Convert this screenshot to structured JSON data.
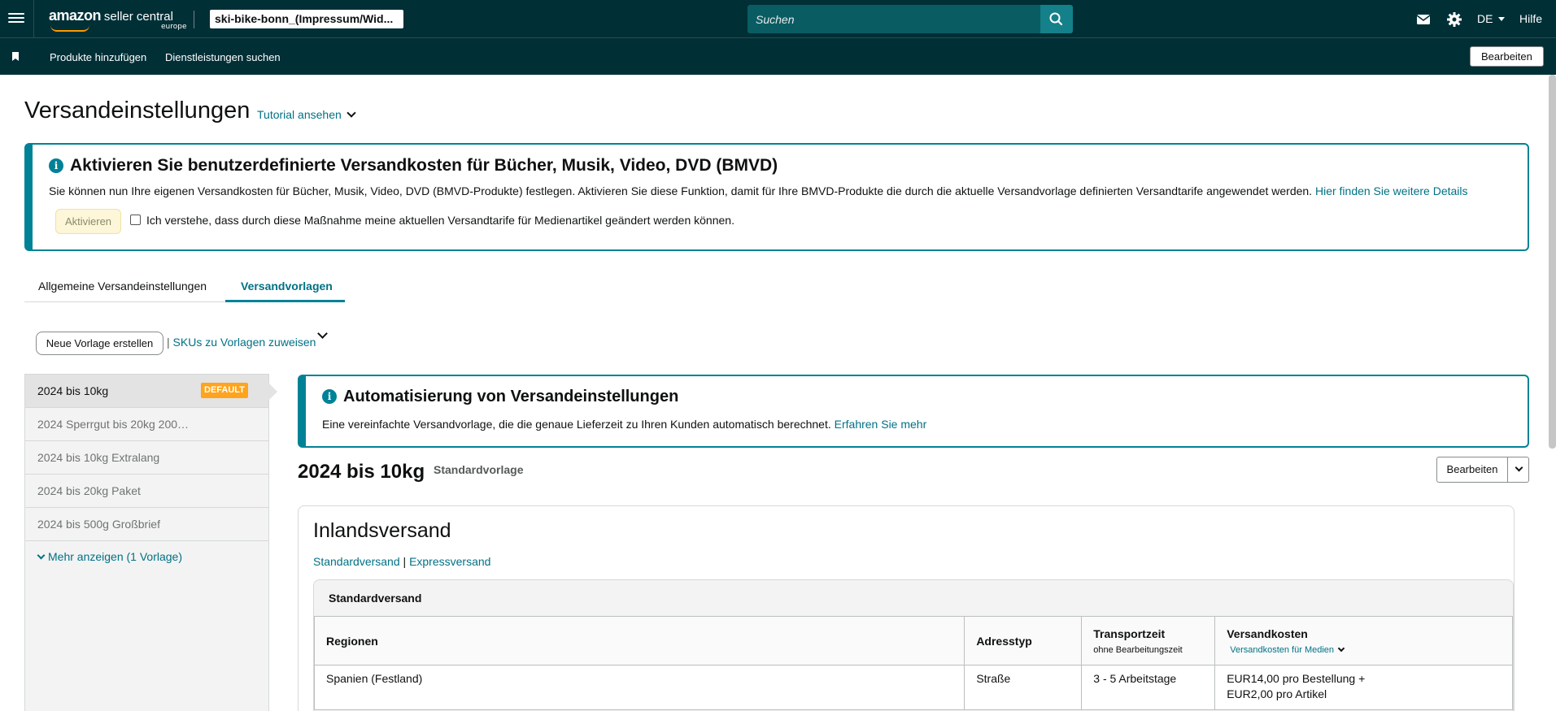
{
  "header": {
    "logo_main": "amazon",
    "logo_rest": "seller central",
    "logo_sub": "europe",
    "account": "ski-bike-bonn_(Impressum/Wid...",
    "search_placeholder": "Suchen",
    "language": "DE",
    "help": "Hilfe",
    "icons": [
      "menu-icon",
      "mail-icon",
      "gear-icon",
      "search-icon",
      "bookmark-icon"
    ]
  },
  "subnav": {
    "items": [
      "Produkte hinzufügen",
      "Dienstleistungen suchen"
    ],
    "edit": "Bearbeiten"
  },
  "page": {
    "title": "Versandeinstellungen",
    "tutorial": "Tutorial ansehen"
  },
  "bmvd_alert": {
    "title": "Aktivieren Sie benutzerdefinierte Versandkosten für Bücher, Musik, Video, DVD (BMVD)",
    "text": "Sie können nun Ihre eigenen Versandkosten für Bücher, Musik, Video, DVD (BMVD-Produkte) festlegen. Aktivieren Sie diese Funktion, damit für Ihre BMVD-Produkte die durch die aktuelle Versandvorlage definierten Versandtarife angewendet werden.",
    "link": "Hier finden Sie weitere Details",
    "button": "Aktivieren",
    "checkbox_label": "Ich verstehe, dass durch diese Maßnahme meine aktuellen Versandtarife für Medienartikel geändert werden können.",
    "checked": false
  },
  "tabs": [
    {
      "label": "Allgemeine Versandeinstellungen",
      "active": false
    },
    {
      "label": "Versandvorlagen",
      "active": true
    }
  ],
  "actions": {
    "new_template": "Neue Vorlage erstellen",
    "pipe": "|",
    "assign": "SKUs zu Vorlagen zuweisen"
  },
  "templates": {
    "items": [
      {
        "label": "2024 bis 10kg",
        "active": true,
        "badge": "DEFAULT"
      },
      {
        "label": "2024 Sperrgut bis 20kg 200…",
        "active": false
      },
      {
        "label": "2024 bis 10kg Extralang",
        "active": false
      },
      {
        "label": "2024 bis 20kg Paket",
        "active": false
      },
      {
        "label": "2024 bis 500g Großbrief",
        "active": false
      }
    ],
    "more": "Mehr anzeigen (1 Vorlage)"
  },
  "auto_alert": {
    "title": "Automatisierung von Versandeinstellungen",
    "text": "Eine vereinfachte Versandvorlage, die die genaue Lieferzeit zu Ihren Kunden automatisch berechnet.",
    "link": "Erfahren Sie mehr"
  },
  "template_detail": {
    "title": "2024 bis 10kg",
    "type": "Standardvorlage",
    "edit": "Bearbeiten",
    "section_title": "Inlandsversand",
    "link_standard": "Standardversand",
    "pipe": "|",
    "link_express": "Expressversand",
    "table_title": "Standardversand",
    "columns": {
      "regions": "Regionen",
      "address_type": "Adresstyp",
      "transit": "Transportzeit",
      "transit_sub": "ohne Bearbeitungszeit",
      "cost": "Versandkosten",
      "cost_link": "Versandkosten für Medien"
    },
    "rows": [
      {
        "region": "Spanien (Festland)",
        "address": "Straße",
        "transit": "3 - 5 Arbeitstage",
        "cost_line1": "EUR14,00 pro Bestellung +",
        "cost_line2": "EUR2,00 pro Artikel"
      }
    ]
  },
  "colors": {
    "nav_bg": "#002f36",
    "accent": "#008296",
    "link": "#007185",
    "badge": "#ffa41c"
  }
}
